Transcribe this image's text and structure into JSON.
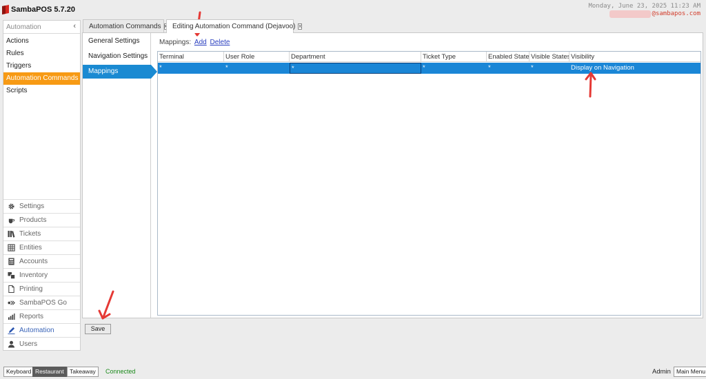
{
  "header": {
    "app_title": "SambaPOS 5.7.20",
    "datetime": "Monday, June 23, 2025 11:23 AM",
    "email": "@sambapos.com",
    "logo_color": "#d7261e"
  },
  "sidebar": {
    "section_title": "Automation",
    "collapse_glyph": "‹",
    "items": [
      {
        "label": "Actions"
      },
      {
        "label": "Rules"
      },
      {
        "label": "Triggers"
      },
      {
        "label": "Automation Commands",
        "active": true
      },
      {
        "label": "Scripts"
      }
    ],
    "active_color": "#f79a14"
  },
  "nav": {
    "items": [
      {
        "label": "Settings",
        "icon": "gear-icon"
      },
      {
        "label": "Products",
        "icon": "coffee-cup-icon"
      },
      {
        "label": "Tickets",
        "icon": "tickets-icon"
      },
      {
        "label": "Entities",
        "icon": "entities-icon"
      },
      {
        "label": "Accounts",
        "icon": "calculator-icon"
      },
      {
        "label": "Inventory",
        "icon": "inventory-icon"
      },
      {
        "label": "Printing",
        "icon": "document-icon"
      },
      {
        "label": "SambaPOS Go",
        "icon": "go-icon"
      },
      {
        "label": "Reports",
        "icon": "bar-chart-icon"
      },
      {
        "label": "Automation",
        "icon": "pen-icon",
        "active": true
      },
      {
        "label": "Users",
        "icon": "user-icon"
      }
    ]
  },
  "tabs": [
    {
      "label": "Automation Commands",
      "close": "x"
    },
    {
      "label": "Editing Automation Command (Dejavoo)",
      "close": "x",
      "active": true
    }
  ],
  "settings_nav": {
    "items": [
      {
        "label": "General Settings"
      },
      {
        "label": "Navigation Settings"
      },
      {
        "label": "Mappings",
        "active": true
      }
    ],
    "active_color": "#1a8ad2"
  },
  "mappings": {
    "label": "Mappings:",
    "add_link": "Add",
    "delete_link": "Delete",
    "columns": [
      "Terminal",
      "User Role",
      "Department",
      "Ticket Type",
      "Enabled States",
      "Visible States",
      "Visibility"
    ],
    "rows": [
      [
        "*",
        "*",
        "*",
        "*",
        "*",
        "*",
        "Display on Navigation"
      ]
    ],
    "selected_row_color": "#1a86d6"
  },
  "actions": {
    "save_label": "Save"
  },
  "footer": {
    "keyboard": "Keyboard",
    "restaurant": "Restaurant",
    "takeaway": "Takeaway",
    "status": "Connected",
    "user": "Admin",
    "main_menu": "Main Menu"
  },
  "annotation_color": "#e53935"
}
